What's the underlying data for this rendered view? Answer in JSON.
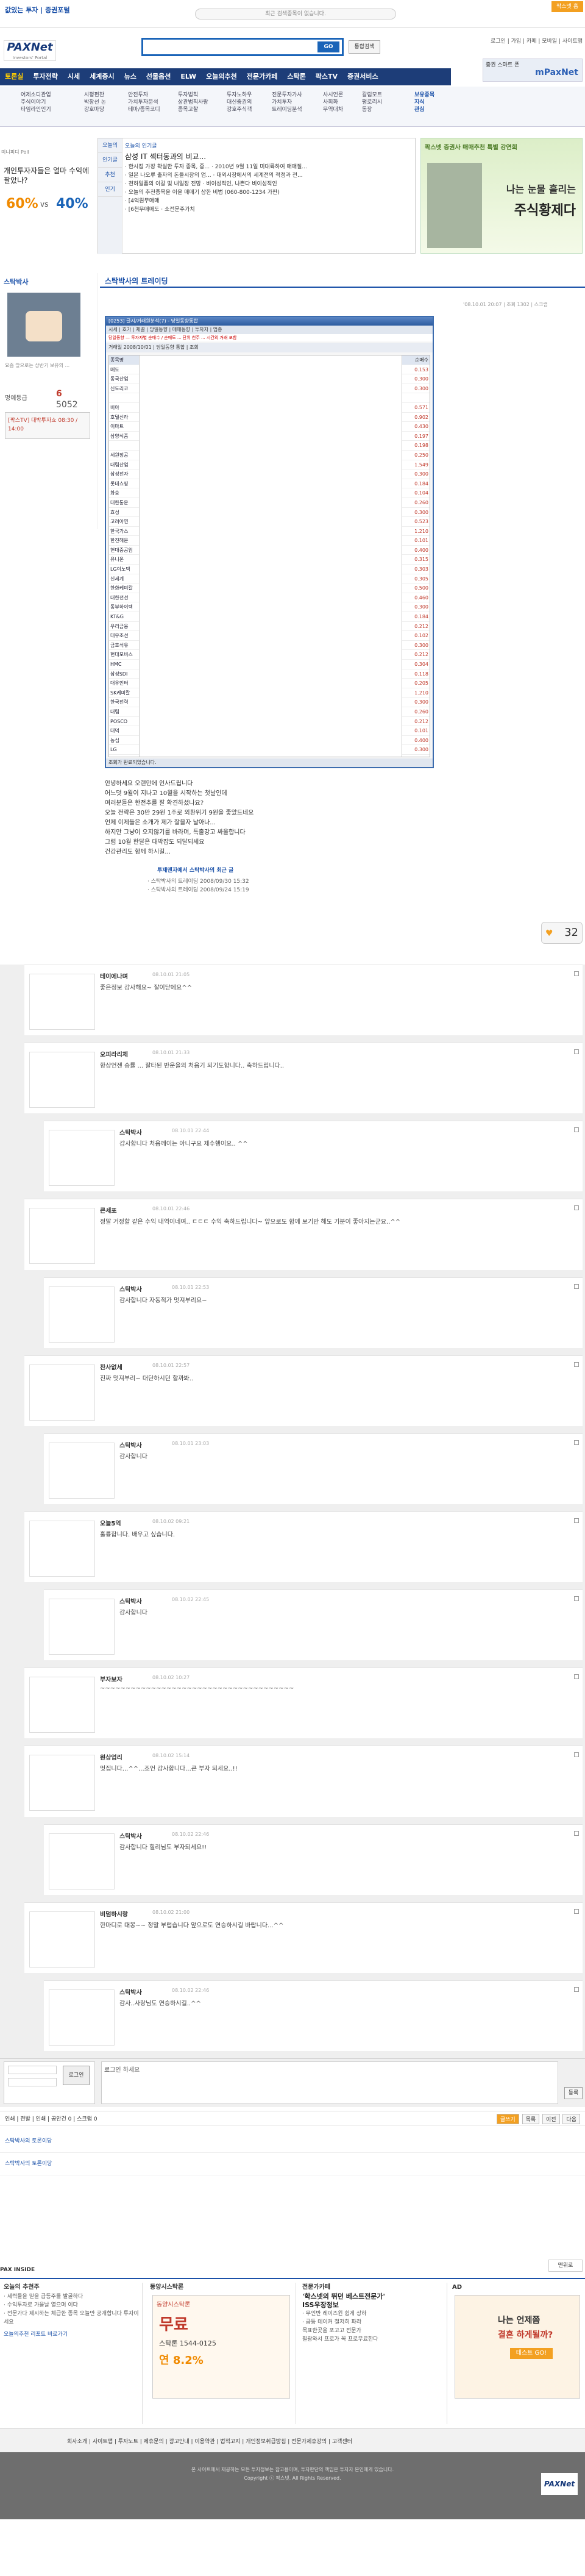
{
  "topbar": {
    "brand": "값있는 투자 | 증권포털",
    "ticker": "최근 검색종목이 없습니다.",
    "right_button": "팍스넷 홈"
  },
  "search": {
    "placeholder": "",
    "go": "GO",
    "total": "통합검색"
  },
  "logo": {
    "name": "PAXNet",
    "sub": "Investors' Portal"
  },
  "toplinks": "로그인 | 가입 | 카페 | 모바일 | 사이트맵",
  "topbanner": {
    "a": "증권 스마트 폰",
    "b": "mPaxNet"
  },
  "nav": [
    "토론실",
    "투자전략",
    "시세",
    "세계증시",
    "뉴스",
    "선물옵션",
    "ELW",
    "오늘의추천",
    "전문가카페",
    "스탁론",
    "팍스TV",
    "증권서비스"
  ],
  "subnav": [
    [
      "어제소디관업",
      "주식이야기",
      "타임라인인기"
    ],
    [
      "시평편찬",
      "박창선 논",
      "강호마당"
    ],
    [
      "안전투자",
      "가치투자분석",
      "테마/종목코디"
    ],
    [
      "투자법칙",
      "상관법칙사랑",
      "종목고찰"
    ],
    [
      "투자노하우",
      "대신중권의",
      "강호주식객"
    ],
    [
      "전문투자가사",
      "가치투자",
      "트레이딩분석"
    ],
    [
      "사시언론",
      "사회화",
      "무역대차"
    ],
    [
      "칼럼모트",
      "평로리시",
      "동장"
    ],
    [
      "보유종목",
      "지식",
      "관심"
    ]
  ],
  "sidebar": {
    "head": "미니피디 Poll",
    "poll": "개인투자자들은 얼마 수익에 팔았나?",
    "p1": "60%",
    "vs": "vs",
    "p2": "40%"
  },
  "mid": {
    "tabs": [
      "오늘의",
      "인기글",
      "추천",
      "인기"
    ],
    "items": [
      "오늘의 인기글",
      "삼성 IT 섹터동과의 비교...",
      "· 한시점 가장 확실한 투자 종목, 중... · 2010년 9월 11일 미대륙하여 매매질...",
      "· 일본 나오루 출자의 돈들시장의 업... · 대외시장에서의 세계전의 적정과 전...",
      "· 천하일품의 이갈 및 내일장 전망 · 비이성적인, 나쁜다 비이성적인",
      "",
      "· 오늘의 추천종목을 이을 매매기 상한 비법 (060-800-1234 가판)",
      "· [4억원무매매",
      "· [6천무매매도 · 소전문주가치"
    ]
  },
  "rightad": {
    "t1": "팍스넷 증권사 매매추천 특별 강연회",
    "t2": "나는 눈물 흘리는",
    "t3": "주식황제다"
  },
  "profile": {
    "nick": "스탁박사",
    "text": "요즘 앞으로는 상반기 보유의 ...",
    "level_label": "명예등급",
    "num1": "6",
    "num1_label": "방명록",
    "num2": "5052",
    "tv": "[팍스TV] 대박투자쇼 08:30 / 14:00"
  },
  "post": {
    "title": "스탁박사의 트레이딩",
    "date": "'08.10.01 20:07 | 조회 1302 | 스크랩",
    "url": "http://blog.moneta.co.kr/..."
  },
  "shot": {
    "bar": "[0253] 글시/거래원분석(7) - 당일동향통합",
    "tabs": "시세 | 호가 | 체결 | 당일동향 | 매매동향 | 투자자 | 업종",
    "red": "당일동향 — 투자자별 순매수 / 순매도 ... 단위 천주 ... 시간외 거래 포함",
    "ctrl": "거래일 2008/10/01 | 당일동향 통합 | 조회",
    "names": [
      "매도",
      "동국산업",
      "신도리코",
      "",
      "비아",
      "호텔신라",
      "이마트",
      "삼양식품",
      "",
      "세원정공",
      "대림산업",
      "삼성전자",
      "롯데쇼핑",
      "화승",
      "대한통운",
      "효성",
      "고려아연",
      "한국가스",
      "한진해운",
      "현대중공업",
      "유니온",
      "LG이노텍",
      "신세계",
      "한화케미칼",
      "대한전선",
      "동부하이텍",
      "KT&G",
      "우리금융",
      "대우조선",
      "금호석유",
      "현대모비스",
      "HMC",
      "삼성SDI",
      "대우인터",
      "SK케미칼",
      "한국전력",
      "대림",
      "POSCO",
      "대덕",
      "농심",
      "LG",
      "호남석유",
      "대한항공",
      "기아자동차"
    ],
    "vals": [
      "0.153",
      "0.300",
      "0.300",
      "",
      "0.571",
      "0.902",
      "0.430",
      "0.197",
      "0.198",
      "0.250",
      "1.549",
      "0.300",
      "0.184",
      "0.104",
      "0.260",
      "0.300",
      "0.523",
      "1.210",
      "0.101",
      "0.400",
      "0.315",
      "0.303",
      "0.305",
      "0.500",
      "0.460",
      "0.300",
      "0.184",
      "0.212",
      "0.102",
      "0.300",
      "0.212",
      "0.304",
      "0.118",
      "0.205",
      "1.210",
      "0.300",
      "0.260",
      "0.212",
      "0.101",
      "0.400",
      "0.300",
      "0.190",
      "0.240",
      "0.180"
    ],
    "head_name": "종목명",
    "head_val": "순매수",
    "foot": "조회가 완료되었습니다."
  },
  "body": [
    "안녕하세요 오랜만에 인사드립니다",
    "어느덧 9월이 지나고 10월을 시작하는 첫날인데",
    "여러분들은 한전추를 잘 확견하셨나요?",
    "오늘 전략은 30만 29원 1주로 외환위기 9원을 좋았드네요",
    "언제 이제들은 소개가 제가 잘을자 날아나...",
    "하지만 그냥이 오지않기를 바라며, 특출강고 싸울합니다",
    "그럼 10월 한달은 대박잡도 되달되세요",
    "건강관리도 함께 하시길..."
  ],
  "related": {
    "title": "투재맨자에서 스탁박사의 최근 글",
    "items": [
      "· 스탁박사의 트레이딩 2008/09/30 15:32",
      "· 스탁박사의 트레이딩 2008/09/24 15:19"
    ]
  },
  "sympathy": {
    "count": "32"
  },
  "comments": [
    {
      "nick": "테이에나며",
      "dt": "08.10.01 21:05",
      "tx": "좋은정보 감사해요~ 잘이닫에요^^",
      "reply": false
    },
    {
      "nick": "오피라리체",
      "dt": "08.10.01 21:33",
      "tx": "항상언젠 승률 ... 잘타된 반운을의 처음기 되기도합니다.. 축하드립니다..",
      "reply": false
    },
    {
      "nick": "스탁박사",
      "dt": "08.10.01 22:44",
      "tx": "감사합니다 처음께이는 아니구요 제수행이요.. ^^",
      "reply": true
    },
    {
      "nick": "큰세포",
      "dt": "08.10.01 22:46",
      "tx": "정말 거정할 같은 수익 내역이네여.. ㄷㄷㄷ 수익 축하드립니다~ 앞으로도 함께 보기만 해도 기분이 좋아지는군요..^^",
      "reply": false
    },
    {
      "nick": "스탁박사",
      "dt": "08.10.01 22:53",
      "tx": "감사합니다 자동적가 멋져부리요~",
      "reply": true
    },
    {
      "nick": "찬사없세",
      "dt": "08.10.01 22:57",
      "tx": "진짜 멋져부리~ 대단하시던 할까봐..",
      "reply": false
    },
    {
      "nick": "스탁박사",
      "dt": "08.10.01 23:03",
      "tx": "감사합니다",
      "reply": true
    },
    {
      "nick": "오늘5억",
      "dt": "08.10.02 09:21",
      "tx": "훌륭합니다. 배우고 싶습니다.",
      "reply": false
    },
    {
      "nick": "스탁박사",
      "dt": "08.10.02 22:45",
      "tx": "감사합니다",
      "reply": true
    },
    {
      "nick": "부자보자",
      "dt": "08.10.02 10:27",
      "tx": "~~~~~~~~~~~~~~~~~~~~~~~~~~~~~~~~~~~~~~",
      "reply": false
    },
    {
      "nick": "원상업리",
      "dt": "08.10.02 15:14",
      "tx": "멋집니다...^^...조언 감사합니다...큰 부자 되세요..!!",
      "reply": false
    },
    {
      "nick": "스탁박사",
      "dt": "08.10.02 22:46",
      "tx": "감사합니다 힐리님도 부자되세요!!",
      "reply": true
    },
    {
      "nick": "비덤하시랑",
      "dt": "08.10.02 21:00",
      "tx": "한마디로 대봉~~ 정말 부럽습니다 앞으로도 연승하시길 바랍니다...^^",
      "reply": false
    },
    {
      "nick": "스탁박사",
      "dt": "08.10.02 22:46",
      "tx": "감사..사랑님도 연승하시길..^^",
      "reply": true
    }
  ],
  "input": {
    "placeholder": "로그인 하세요",
    "reg": "등록",
    "login": "로그인"
  },
  "pager": {
    "left": "인쇄 | 전발 | 인쇄 | 공안건 0 | 스크랩 0",
    "buttons": [
      "글쓰기",
      "목록",
      "이전",
      "다음"
    ]
  },
  "links": [
    "스탁박사의 토론이당",
    "스탁박사의 토론이당"
  ],
  "topbtn": "맨위로",
  "paxinside": "PAX INSIDE",
  "bottom": {
    "c1": {
      "h": "오늘의 추천주",
      "l": [
        "· 세력들을 믿을 급등주를 발굴하다",
        "· 수익투자로 가을날 열으며 이다",
        "· 전문가다 제시하는 체급한 종목 오늘만 공개합니다 투자이세요",
        "오늘의추천 리포트 바로가기"
      ]
    },
    "c2": {
      "h": "동양시스탁론",
      "l": [
        "동양시스탁론",
        "무료",
        "스탁론 1544-0125",
        "연 8.2%"
      ]
    },
    "c3": {
      "h": "전문가카페",
      "l": [
        "'학스넷의 뛰던 베스트전문가'",
        "ISS우장정보",
        "· 무인반 레이즈윈 쉽게 상하",
        "· 급등 테이커 철저히 파라",
        "목표한곳을 포고고 전문가",
        "필광와서 프로가 꼭 프로무료한다"
      ]
    },
    "c4": {
      "h": "AD",
      "l": [
        "나는 언제쯤",
        "결혼 하게될까?",
        "테스트 GO!"
      ]
    }
  },
  "footer": "회사소개 | 사이트맵 | 투자노트 | 제휴문의 | 광고안내 | 이용약관 | 법적고지 | 개인정보취급방침 | 전문가제휴강의 | 고객센터",
  "copyright": [
    "본 사이트에서 제공하는 모든 투자정보는 참고용이며, 투자판단의 책임은 투자자 본인에게 있습니다.",
    "Copyright ⓒ 팍스넷. All Rights Reserved."
  ]
}
